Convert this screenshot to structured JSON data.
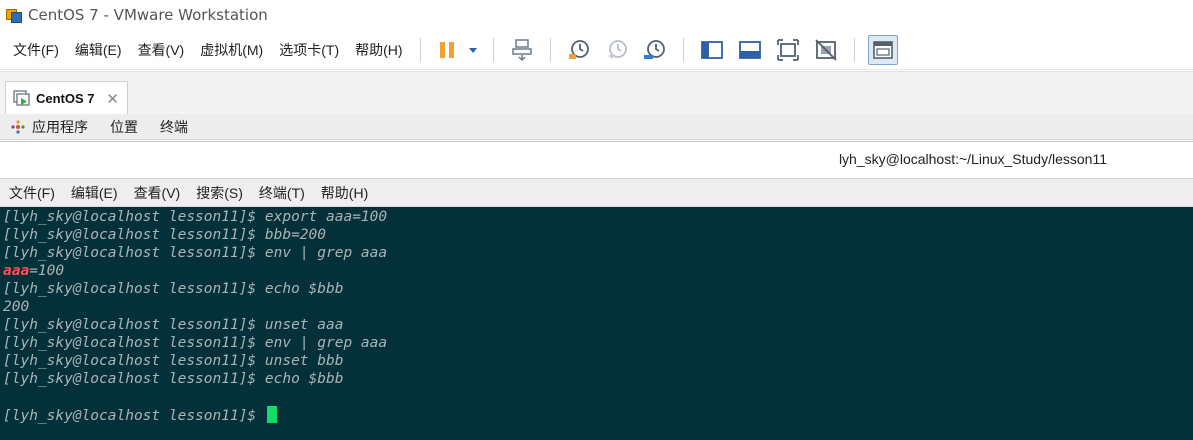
{
  "window": {
    "title": "CentOS 7 - VMware Workstation"
  },
  "menubar": {
    "items": [
      "文件(F)",
      "编辑(E)",
      "查看(V)",
      "虚拟机(M)",
      "选项卡(T)",
      "帮助(H)"
    ]
  },
  "toolbar": {
    "icons": [
      "pause-icon",
      "dropdown-arrow-icon",
      "send-ctrl-alt-del-icon",
      "snapshot-icon",
      "revert-snapshot-icon",
      "snapshot-manager-icon",
      "show-library-icon",
      "quick-switch-icon",
      "full-screen-icon",
      "unity-icon",
      "console-view-icon"
    ],
    "accent": "#f0a030"
  },
  "tab": {
    "label": "CentOS 7",
    "close": "✕"
  },
  "gnome_panel": {
    "items": [
      "应用程序",
      "位置",
      "终端"
    ]
  },
  "terminal": {
    "title": "lyh_sky@localhost:~/Linux_Study/lesson11",
    "menu": [
      "文件(F)",
      "编辑(E)",
      "查看(V)",
      "搜索(S)",
      "终端(T)",
      "帮助(H)"
    ],
    "lines": [
      "[lyh_sky@localhost lesson11]$ export aaa=100",
      "[lyh_sky@localhost lesson11]$ bbb=200",
      "[lyh_sky@localhost lesson11]$ env | grep aaa",
      "=100",
      "[lyh_sky@localhost lesson11]$ echo $bbb",
      "200",
      "[lyh_sky@localhost lesson11]$ unset aaa",
      "[lyh_sky@localhost lesson11]$ env | grep aaa",
      "[lyh_sky@localhost lesson11]$ unset bbb",
      "[lyh_sky@localhost lesson11]$ echo $bbb",
      "",
      "[lyh_sky@localhost lesson11]$ "
    ],
    "match_highlight": "aaa",
    "background": "#04303a",
    "text_color": "#a9b4b6",
    "highlight_color": "#ff4f57",
    "cursor_color": "#11dd66"
  }
}
